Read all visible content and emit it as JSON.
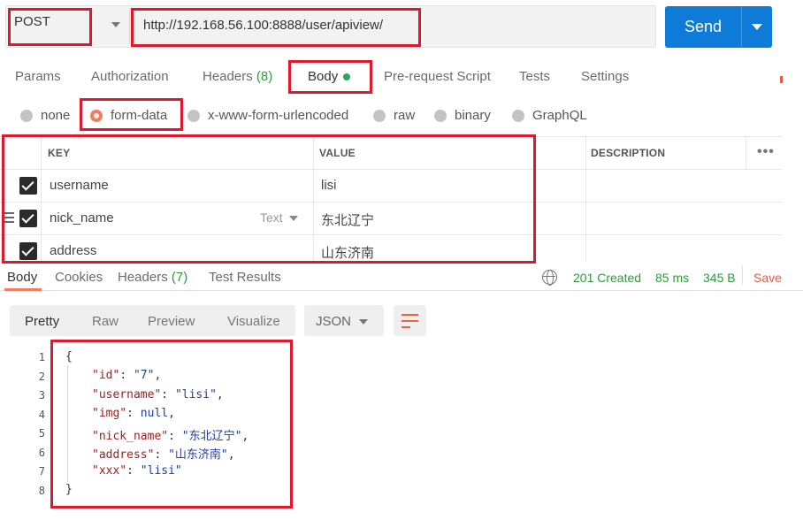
{
  "request": {
    "method": "POST",
    "url": "http://192.168.56.100:8888/user/apiview/",
    "send_label": "Send"
  },
  "request_tabs": [
    {
      "label": "Params"
    },
    {
      "label": "Authorization"
    },
    {
      "label": "Headers",
      "count": "(8)"
    },
    {
      "label": "Body"
    },
    {
      "label": "Pre-request Script"
    },
    {
      "label": "Tests"
    },
    {
      "label": "Settings"
    }
  ],
  "body_types": [
    "none",
    "form-data",
    "x-www-form-urlencoded",
    "raw",
    "binary",
    "GraphQL"
  ],
  "body_type_selected": "form-data",
  "form_table": {
    "headers": {
      "key": "KEY",
      "value": "VALUE",
      "description": "DESCRIPTION"
    },
    "type_label": "Text",
    "rows": [
      {
        "checked": true,
        "key": "username",
        "value": "lisi"
      },
      {
        "checked": true,
        "key": "nick_name",
        "value": "东北辽宁"
      },
      {
        "checked": true,
        "key": "address",
        "value": "山东济南"
      }
    ]
  },
  "response_tabs": [
    {
      "label": "Body"
    },
    {
      "label": "Cookies"
    },
    {
      "label": "Headers",
      "count": "(7)"
    },
    {
      "label": "Test Results"
    }
  ],
  "response_meta": {
    "status": "201 Created",
    "time": "85 ms",
    "size": "345 B",
    "save_label": "Save"
  },
  "view_modes": [
    "Pretty",
    "Raw",
    "Preview",
    "Visualize"
  ],
  "format_select": "JSON",
  "response_lines": [
    {
      "num": "1",
      "open": "{"
    },
    {
      "num": "2",
      "key": "\"id\"",
      "val": "\"7\"",
      "tail": ","
    },
    {
      "num": "3",
      "key": "\"username\"",
      "val": "\"lisi\"",
      "tail": ","
    },
    {
      "num": "4",
      "key": "\"img\"",
      "val": "null",
      "tail": ","
    },
    {
      "num": "5",
      "key": "\"nick_name\"",
      "val": "\"东北辽宁\"",
      "tail": ","
    },
    {
      "num": "6",
      "key": "\"address\"",
      "val": "\"山东济南\"",
      "tail": ","
    },
    {
      "num": "7",
      "key": "\"xxx\"",
      "val": "\"lisi\"",
      "tail": ""
    },
    {
      "num": "8",
      "close": "}"
    }
  ],
  "colors": {
    "accent": "#f07e5e",
    "send": "#0d7bd7",
    "success": "#2e9a3d",
    "highlight_box": "#e0182d"
  },
  "icons": [
    "chevron-down-icon",
    "globe-icon",
    "wrap-lines-icon",
    "more-options-icon",
    "drag-handle-icon",
    "checkbox-checked-icon"
  ]
}
